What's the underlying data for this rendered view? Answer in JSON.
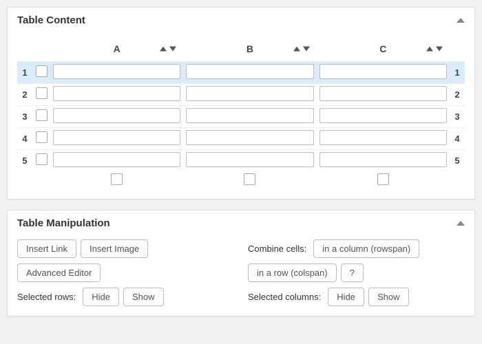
{
  "content_panel": {
    "title": "Table Content"
  },
  "columns": [
    {
      "label": "A"
    },
    {
      "label": "B"
    },
    {
      "label": "C"
    }
  ],
  "rows": [
    {
      "n": "1",
      "selected": true,
      "cells": [
        "",
        "",
        ""
      ]
    },
    {
      "n": "2",
      "selected": false,
      "cells": [
        "",
        "",
        ""
      ]
    },
    {
      "n": "3",
      "selected": false,
      "cells": [
        "",
        "",
        ""
      ]
    },
    {
      "n": "4",
      "selected": false,
      "cells": [
        "",
        "",
        ""
      ]
    },
    {
      "n": "5",
      "selected": false,
      "cells": [
        "",
        "",
        ""
      ]
    }
  ],
  "manip_panel": {
    "title": "Table Manipulation"
  },
  "buttons": {
    "insert_link": "Insert Link",
    "insert_image": "Insert Image",
    "advanced_editor": "Advanced Editor",
    "hide": "Hide",
    "show": "Show",
    "rowspan": "in a column (rowspan)",
    "colspan": "in a row (colspan)",
    "help": "?"
  },
  "labels": {
    "combine_cells": "Combine cells:",
    "selected_rows": "Selected rows:",
    "selected_columns": "Selected columns:"
  }
}
